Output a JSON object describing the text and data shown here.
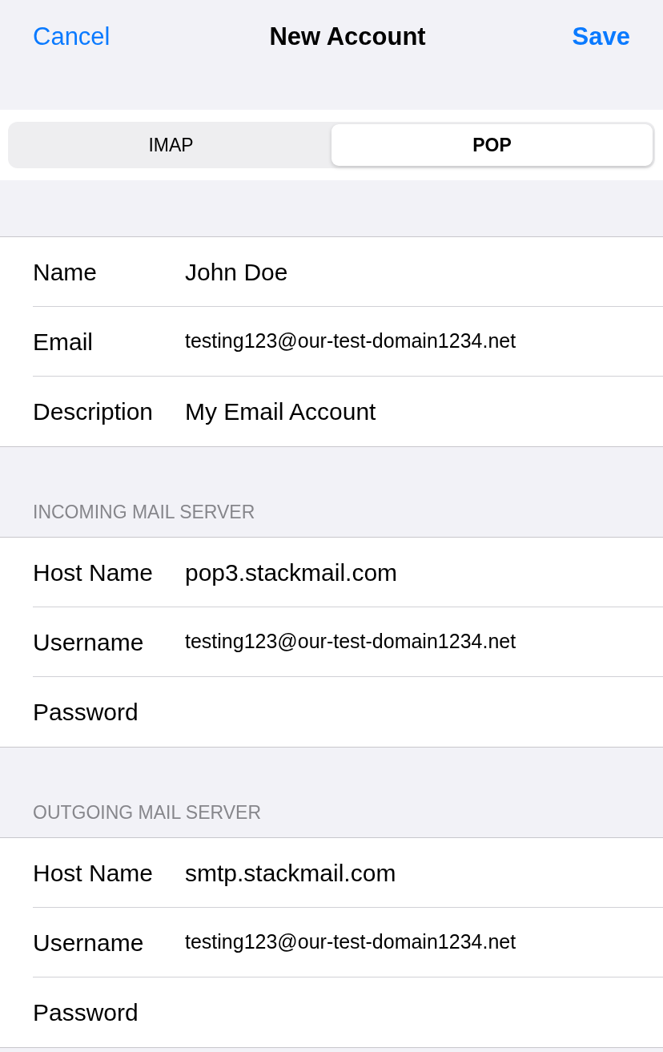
{
  "nav": {
    "cancel": "Cancel",
    "title": "New Account",
    "save": "Save"
  },
  "segments": [
    {
      "label": "IMAP",
      "selected": false
    },
    {
      "label": "POP",
      "selected": true
    }
  ],
  "sections": [
    {
      "rows": [
        {
          "label": "Name",
          "value": "John Doe",
          "kind": "text"
        },
        {
          "label": "Email",
          "value": "testing123@our-test-domain1234.net",
          "kind": "email"
        },
        {
          "label": "Description",
          "value": "My Email Account",
          "kind": "text"
        }
      ]
    },
    {
      "header": "INCOMING MAIL SERVER",
      "rows": [
        {
          "label": "Host Name",
          "value": "pop3.stackmail.com",
          "kind": "text"
        },
        {
          "label": "Username",
          "value": "testing123@our-test-domain1234.net",
          "kind": "email"
        },
        {
          "label": "Password",
          "kind": "password"
        }
      ]
    },
    {
      "header": "OUTGOING MAIL SERVER",
      "rows": [
        {
          "label": "Host Name",
          "value": "smtp.stackmail.com",
          "kind": "text"
        },
        {
          "label": "Username",
          "value": "testing123@our-test-domain1234.net",
          "kind": "email"
        },
        {
          "label": "Password",
          "kind": "password"
        }
      ]
    }
  ]
}
